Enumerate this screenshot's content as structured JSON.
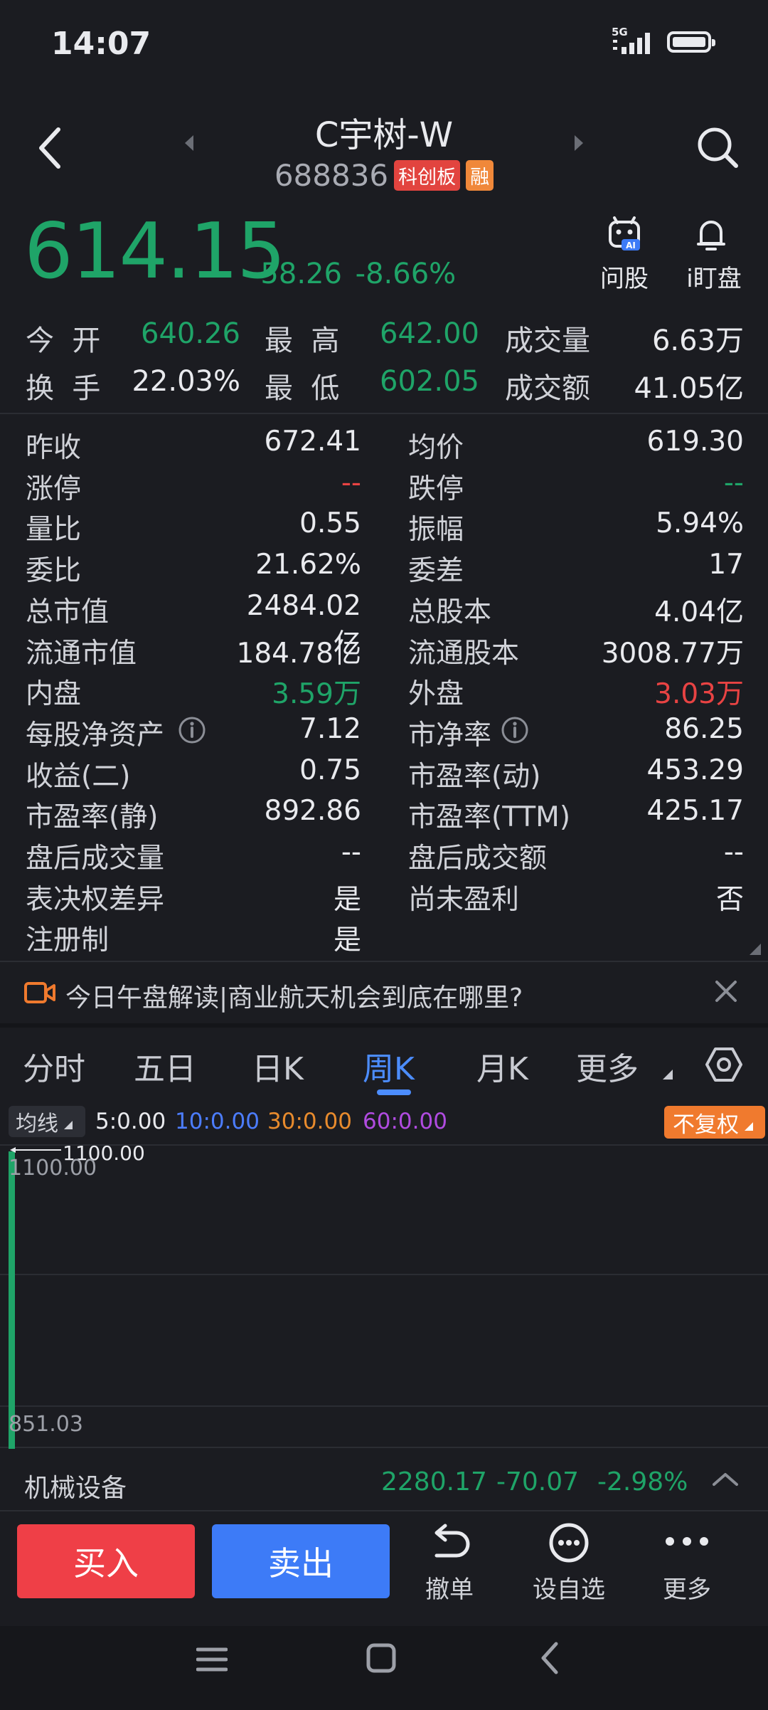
{
  "status": {
    "time": "14:07",
    "network": "5G"
  },
  "header": {
    "title": "C宇树-W",
    "code": "688836",
    "tag_board": "科创板",
    "tag_margin": "融"
  },
  "price": {
    "last": "614.15",
    "change": "-58.26",
    "pct": "-8.66%"
  },
  "actions_top": {
    "ask": "问股",
    "watch": "i盯盘"
  },
  "quote_rows": [
    {
      "l1": "今  开",
      "v1": "640.26",
      "l2": "最  高",
      "v2": "642.00",
      "l3": "成交量",
      "v3": "6.63万"
    },
    {
      "l1": "换  手",
      "v1": "22.03%",
      "l2": "最  低",
      "v2": "602.05",
      "l3": "成交额",
      "v3": "41.05亿"
    }
  ],
  "stats": [
    {
      "l": "昨收",
      "v": "672.41",
      "l2": "均价",
      "v2": "619.30"
    },
    {
      "l": "涨停",
      "v": "--",
      "l2": "跌停",
      "v2": "--"
    },
    {
      "l": "量比",
      "v": "0.55",
      "l2": "振幅",
      "v2": "5.94%"
    },
    {
      "l": "委比",
      "v": "21.62%",
      "l2": "委差",
      "v2": "17"
    },
    {
      "l": "总市值",
      "v": "2484.02亿",
      "l2": "总股本",
      "v2": "4.04亿"
    },
    {
      "l": "流通市值",
      "v": "184.78亿",
      "l2": "流通股本",
      "v2": "3008.77万"
    },
    {
      "l": "内盘",
      "v": "3.59万",
      "l2": "外盘",
      "v2": "3.03万"
    },
    {
      "l": "每股净资产",
      "v": "7.12",
      "l2": "市净率",
      "v2": "86.25"
    },
    {
      "l": "收益(二)",
      "v": "0.75",
      "l2": "市盈率(动)",
      "v2": "453.29"
    },
    {
      "l": "市盈率(静)",
      "v": "892.86",
      "l2": "市盈率(TTM)",
      "v2": "425.17"
    },
    {
      "l": "盘后成交量",
      "v": "--",
      "l2": "盘后成交额",
      "v2": "--"
    },
    {
      "l": "表决权差异",
      "v": "是",
      "l2": "尚未盈利",
      "v2": "否"
    },
    {
      "l": "注册制",
      "v": "是",
      "l2": "",
      "v2": ""
    }
  ],
  "notice": {
    "text": "今日午盘解读|商业航天机会到底在哪里?"
  },
  "tabs": [
    "分时",
    "五日",
    "日K",
    "周K",
    "月K",
    "更多"
  ],
  "active_tab": "周K",
  "ma": {
    "button": "均线",
    "ma5": "5:0.00",
    "ma10": "10:0.00",
    "ma30": "30:0.00",
    "ma60": "60:0.00",
    "adjust": "不复权",
    "colors": {
      "ma5": "#e9eaee",
      "ma10": "#4c7dff",
      "ma30": "#e88b2d",
      "ma60": "#b04be0"
    }
  },
  "chart_data": {
    "type": "candlestick",
    "y_max_label": "1100.00",
    "y_min_label": "851.03",
    "marker_label": "1100.00",
    "ylim": [
      851.03,
      1100.0
    ]
  },
  "sector": {
    "name": "机械设备",
    "value": "2280.17",
    "change": "-70.07",
    "pct": "-2.98%"
  },
  "bottom": {
    "buy": "买入",
    "sell": "卖出",
    "cancel": "撤单",
    "watchlist": "设自选",
    "more": "更多"
  }
}
